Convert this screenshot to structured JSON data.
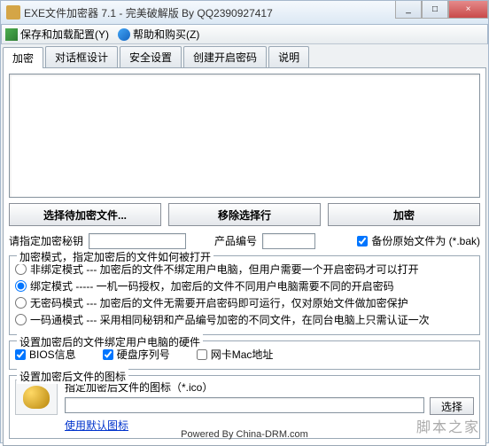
{
  "window": {
    "title": "EXE文件加密器 7.1 - 完美破解版 By QQ2390927417",
    "min": "_",
    "max": "□",
    "close": "×"
  },
  "menu": {
    "save_config": "保存和加载配置(Y)",
    "help_buy": "帮助和购买(Z)"
  },
  "tabs": {
    "encrypt": "加密",
    "dialog": "对话框设计",
    "security": "安全设置",
    "create_pw": "创建开启密码",
    "about": "说明"
  },
  "buttons": {
    "select_file": "选择待加密文件...",
    "remove_sel": "移除选择行",
    "encrypt": "加密",
    "browse": "选择"
  },
  "form": {
    "key_label": "请指定加密秘钥",
    "product_label": "产品编号",
    "backup_label": "备份原始文件为 (*.bak)"
  },
  "mode_group": {
    "legend": "加密模式，指定加密后的文件如何被打开",
    "r1": "非绑定模式 --- 加密后的文件不绑定用户电脑，但用户需要一个开启密码才可以打开",
    "r2": "绑定模式 ----- 一机一码授权，加密后的文件不同用户电脑需要不同的开启密码",
    "r3": "无密码模式 --- 加密后的文件无需要开启密码即可运行，仅对原始文件做加密保护",
    "r4": "一码通模式 --- 采用相同秘钥和产品编号加密的不同文件，在同台电脑上只需认证一次"
  },
  "hw_group": {
    "legend": "设置加密后的文件绑定用户电脑的硬件",
    "c1": "BIOS信息",
    "c2": "硬盘序列号",
    "c3": "网卡Mac地址"
  },
  "icon_group": {
    "legend": "设置加密后文件的图标",
    "hint": "指定加密后文件的图标（*.ico）",
    "default_link": "使用默认图标"
  },
  "footer": "Powered By China-DRM.com",
  "watermark": "脚本之家"
}
